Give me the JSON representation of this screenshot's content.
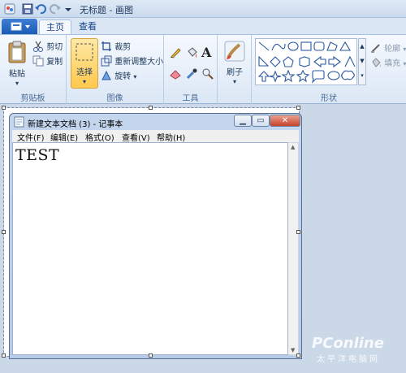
{
  "titlebar": {
    "app_title": "无标题 - 画图"
  },
  "tabs": {
    "home": "主页",
    "view": "查看"
  },
  "clipboard": {
    "paste": "粘贴",
    "cut": "剪切",
    "copy": "复制",
    "label": "剪贴板"
  },
  "image": {
    "select": "选择",
    "crop": "裁剪",
    "resize": "重新调整大小",
    "rotate": "旋转",
    "label": "图像"
  },
  "tools": {
    "label": "工具"
  },
  "brushes": {
    "label": "刷子"
  },
  "shapes": {
    "outline": "轮廓",
    "fill": "填充",
    "label": "形状"
  },
  "notepad": {
    "title": "新建文本文档 (3) - 记事本",
    "menus": [
      "文件(F)",
      "编辑(E)",
      "格式(O)",
      "查看(V)",
      "帮助(H)"
    ],
    "content": "TEST"
  },
  "watermark": {
    "brand": "PConline",
    "tagline": "太平洋电脑网"
  }
}
